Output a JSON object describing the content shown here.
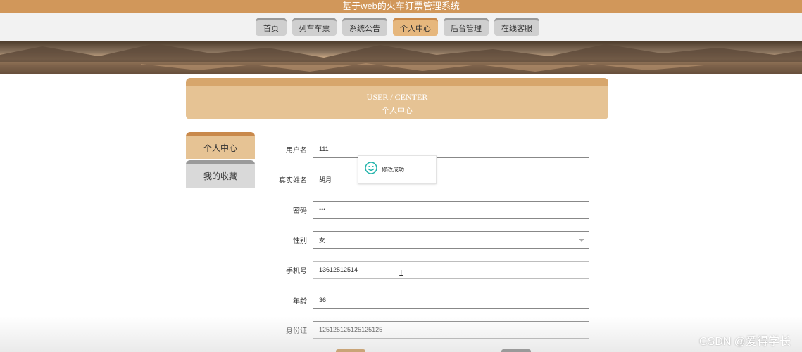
{
  "header": {
    "site_title": "基于web的火车订票管理系统"
  },
  "nav": {
    "items": [
      {
        "label": "首页"
      },
      {
        "label": "列车车票"
      },
      {
        "label": "系统公告"
      },
      {
        "label": "个人中心"
      },
      {
        "label": "后台管理"
      },
      {
        "label": "在线客服"
      }
    ],
    "active": "个人中心"
  },
  "section": {
    "title_en": "USER / CENTER",
    "title_cn": "个人中心"
  },
  "sidebar": {
    "items": [
      {
        "label": "个人中心"
      },
      {
        "label": "我的收藏"
      }
    ]
  },
  "form": {
    "username": {
      "label": "用户名",
      "value": "111"
    },
    "realname": {
      "label": "真实姓名",
      "value": "胡月"
    },
    "password": {
      "label": "密码",
      "value": "•••"
    },
    "gender": {
      "label": "性别",
      "value": "女"
    },
    "phone": {
      "label": "手机号",
      "value": "13612512514"
    },
    "age": {
      "label": "年龄",
      "value": "36"
    },
    "idcard": {
      "label": "身份证",
      "value": "125125125125125125"
    }
  },
  "toast": {
    "message": "修改成功",
    "icon": "smile-icon",
    "color": "#20b2aa"
  },
  "watermark": {
    "text": "CSDN @爱得学长"
  },
  "colors": {
    "accent": "#d1975a",
    "tab_active": "#e6b77d",
    "tab_inactive": "#cfcfcf"
  }
}
